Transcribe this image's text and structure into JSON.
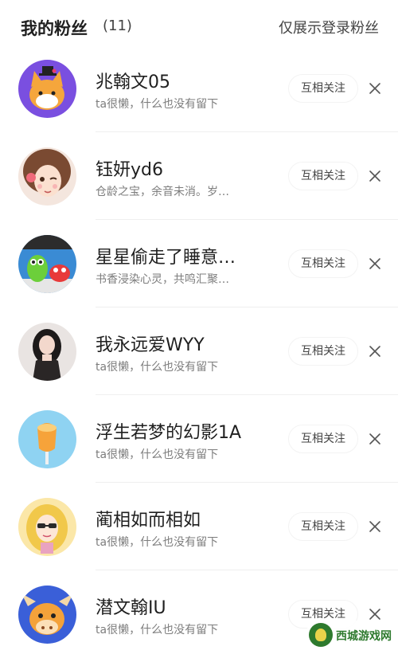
{
  "header": {
    "title": "我的粉丝",
    "count": "(11)",
    "filter_label": "仅展示登录粉丝"
  },
  "fans": [
    {
      "name": "兆翰文05",
      "bio": "ta很懒，什么也没有留下",
      "button": "互相关注"
    },
    {
      "name": "钰妍yd6",
      "bio": "仓龄之宝，余音未消。岁…",
      "button": "互相关注"
    },
    {
      "name": "星星偷走了睡意…",
      "bio": "书香浸染心灵，共鸣汇聚…",
      "button": "互相关注"
    },
    {
      "name": "我永远爱WYY",
      "bio": "ta很懒，什么也没有留下",
      "button": "互相关注"
    },
    {
      "name": "浮生若梦的幻影1A",
      "bio": "ta很懒，什么也没有留下",
      "button": "互相关注"
    },
    {
      "name": "蔺相如而相如",
      "bio": "ta很懒，什么也没有留下",
      "button": "互相关注"
    },
    {
      "name": "潜文翰IU",
      "bio": "ta很懒，什么也没有留下",
      "button": "互相关注"
    }
  ],
  "watermark": {
    "text": "西城游戏网"
  },
  "colors": {
    "text_primary": "#1f1f1f",
    "text_secondary": "#7d7d7d",
    "divider": "#efefef"
  }
}
